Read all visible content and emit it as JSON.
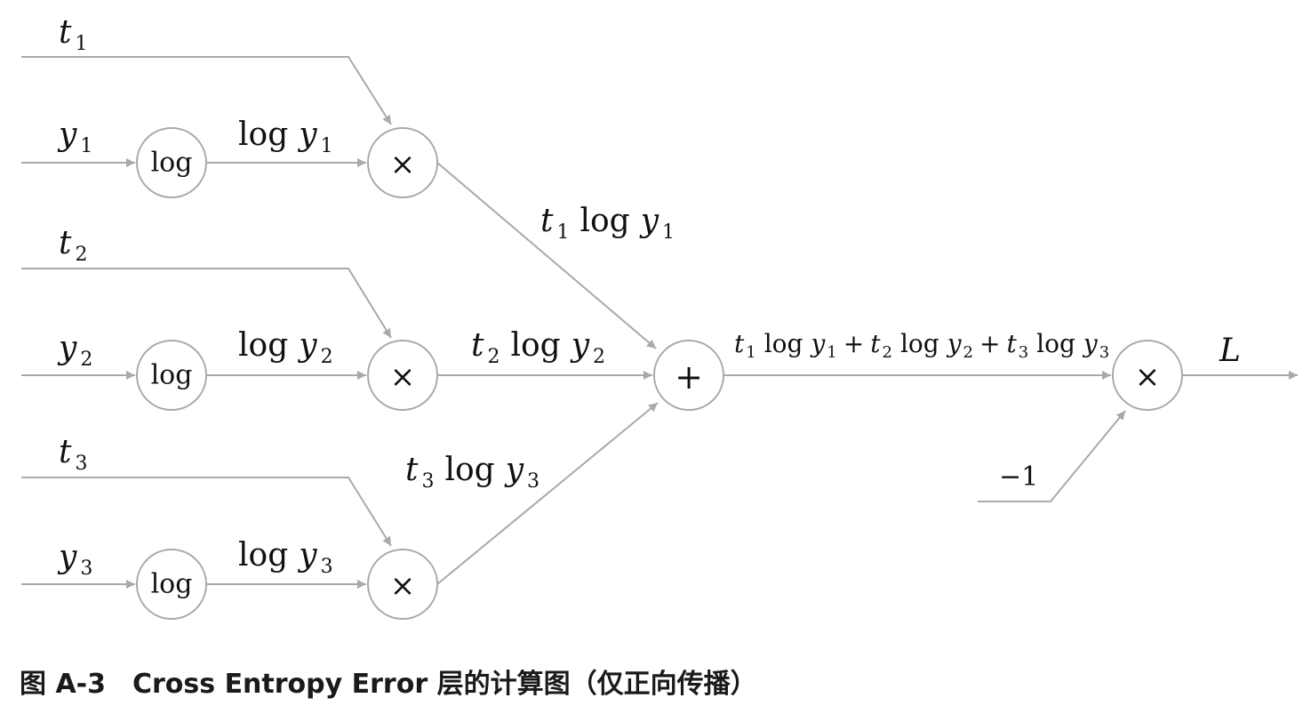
{
  "diagram": {
    "nodes": {
      "log1": "log",
      "log2": "log",
      "log3": "log",
      "mul1": "×",
      "mul2": "×",
      "mul3": "×",
      "add": "+",
      "mul_out": "×"
    },
    "inputs": {
      "t1": {
        "var": "t",
        "sub": "1"
      },
      "y1": {
        "var": "y",
        "sub": "1"
      },
      "t2": {
        "var": "t",
        "sub": "2"
      },
      "y2": {
        "var": "y",
        "sub": "2"
      },
      "t3": {
        "var": "t",
        "sub": "3"
      },
      "y3": {
        "var": "y",
        "sub": "3"
      },
      "neg_one": "−1"
    },
    "edge_labels": {
      "log_y1": {
        "fn": "log",
        "var": "y",
        "sub": "1"
      },
      "log_y2": {
        "fn": "log",
        "var": "y",
        "sub": "2"
      },
      "log_y3": {
        "fn": "log",
        "var": "y",
        "sub": "3"
      },
      "t1_log_y1": {
        "t": "t",
        "t_sub": "1",
        "fn": "log",
        "y": "y",
        "y_sub": "1"
      },
      "t2_log_y2": {
        "t": "t",
        "t_sub": "2",
        "fn": "log",
        "y": "y",
        "y_sub": "2"
      },
      "t3_log_y3": {
        "t": "t",
        "t_sub": "3",
        "fn": "log",
        "y": "y",
        "y_sub": "3"
      },
      "sum": {
        "t1": "t",
        "t1_sub": "1",
        "fn1": "log",
        "y1": "y",
        "y1_sub": "1",
        "plus1": "+",
        "t2": "t",
        "t2_sub": "2",
        "fn2": "log",
        "y2": "y",
        "y2_sub": "2",
        "plus2": "+",
        "t3": "t",
        "t3_sub": "3",
        "fn3": "log",
        "y3": "y",
        "y3_sub": "3"
      },
      "output": "L"
    }
  },
  "caption": "图 A-3　Cross Entropy Error 层的计算图（仅正向传播）",
  "colors": {
    "edge": "#a9a9a9",
    "text": "#111111",
    "caption": "#1a1a1a"
  }
}
